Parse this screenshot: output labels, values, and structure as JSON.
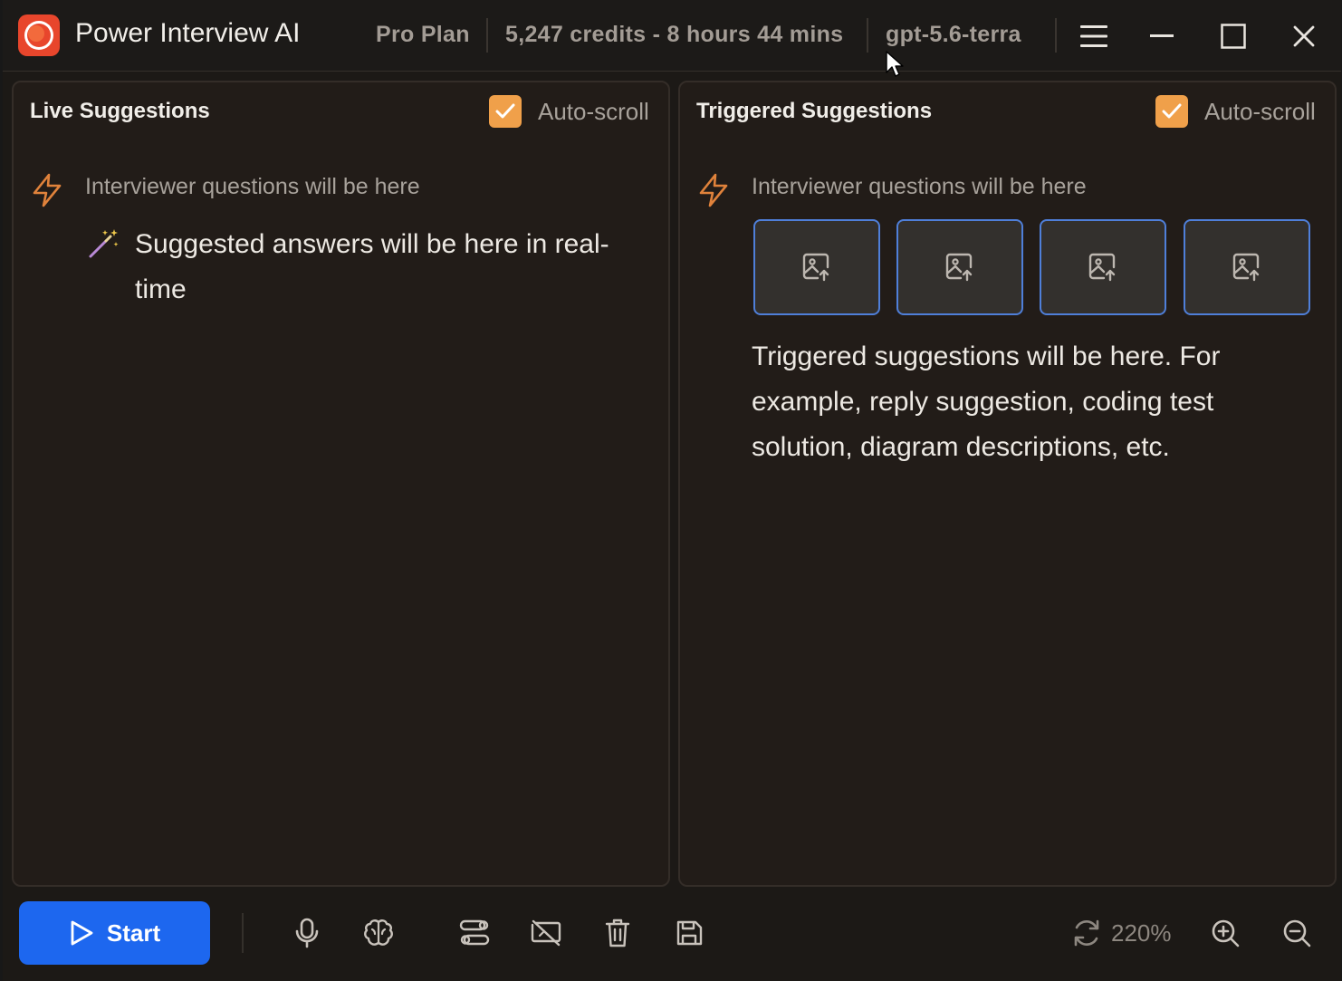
{
  "titlebar": {
    "app_title": "Power Interview AI",
    "plan": "Pro Plan",
    "credits": "5,247 credits - 8 hours 44 mins",
    "model": "gpt-5.6-terra",
    "icons": [
      "app-logo-icon",
      "hamburger-menu-icon",
      "minimize-icon",
      "maximize-icon",
      "close-icon"
    ]
  },
  "live_panel": {
    "title": "Live Suggestions",
    "autoscroll_label": "Auto-scroll",
    "autoscroll_checked": true,
    "question": "Interviewer questions will be here",
    "answer": "Suggested answers will be here in real-time"
  },
  "triggered_panel": {
    "title": "Triggered Suggestions",
    "autoscroll_label": "Auto-scroll",
    "autoscroll_checked": true,
    "question": "Interviewer questions will be here",
    "image_slots": 4,
    "text": "Triggered suggestions will be here. For example, reply suggestion, coding test solution, diagram descriptions, etc."
  },
  "toolbar": {
    "start_label": "Start",
    "zoom": "220%",
    "icons": [
      "microphone-icon",
      "brain-icon",
      "settings-flow-icon",
      "screen-off-icon",
      "trash-icon",
      "save-icon",
      "refresh-icon",
      "zoom-in-icon",
      "zoom-out-icon"
    ]
  },
  "colors": {
    "accent_orange": "#f0a04a",
    "start_blue": "#1d67ef",
    "thumb_border": "#4f7fd9",
    "panel_bg": "#221c18"
  }
}
